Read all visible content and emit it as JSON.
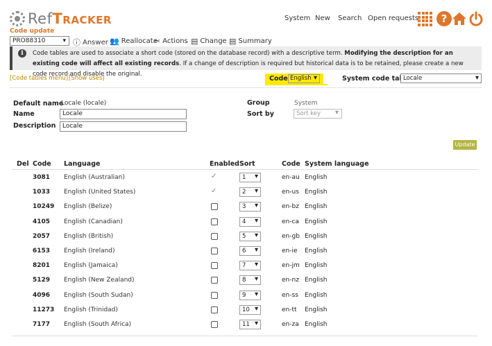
{
  "app": {
    "name_part1": "Ref",
    "name_part2": "Tracker",
    "subtitle": "Code update"
  },
  "topnav": {
    "system": "System",
    "new": "New",
    "search": "Search",
    "open_requests": "Open requests"
  },
  "toolbar": {
    "record": "PRO88310",
    "answer": "Answer",
    "reallocate": "Reallocate",
    "actions": "Actions",
    "change": "Change",
    "summary": "Summary"
  },
  "banner": {
    "part1": "Code tables are used to associate a short code (stored on the database record) with a descriptive term. ",
    "bold": "Modifying the description for an existing code will affect all existing records",
    "part2": ". If a change of description is required but historical data is to be retained, please create a new code record and disable the original."
  },
  "links": {
    "menu": "[Code tables menu]",
    "show_uses": "[Show uses]"
  },
  "code_filter": {
    "label": "Code",
    "value": "English"
  },
  "system_tables": {
    "label": "System code tables",
    "value": "Locale"
  },
  "form": {
    "default_name_label": "Default name",
    "default_name_value": "Locale (locale)",
    "name_label": "Name",
    "name_value": "Locale",
    "description_label": "Description",
    "description_value": "Locale",
    "group_label": "Group",
    "group_value": "System",
    "sortby_label": "Sort by",
    "sortby_value": "Sort key",
    "update_label": "Update"
  },
  "table": {
    "headers": {
      "del": "Del",
      "code": "Code",
      "language": "Language",
      "enabled": "Enabled",
      "sort": "Sort",
      "loc_code": "Code",
      "system_language": "System language"
    },
    "rows": [
      {
        "code": "3081",
        "language": "English (Australian)",
        "enabled": true,
        "sort": "1",
        "loc": "en-au",
        "sys": "English"
      },
      {
        "code": "1033",
        "language": "English (United States)",
        "enabled": true,
        "sort": "2",
        "loc": "en-us",
        "sys": "English"
      },
      {
        "code": "10249",
        "language": "English (Belize)",
        "enabled": false,
        "sort": "3",
        "loc": "en-bz",
        "sys": "English"
      },
      {
        "code": "4105",
        "language": "English (Canadian)",
        "enabled": false,
        "sort": "4",
        "loc": "en-ca",
        "sys": "English"
      },
      {
        "code": "2057",
        "language": "English (British)",
        "enabled": false,
        "sort": "5",
        "loc": "en-gb",
        "sys": "English"
      },
      {
        "code": "6153",
        "language": "English (Ireland)",
        "enabled": false,
        "sort": "6",
        "loc": "en-ie",
        "sys": "English"
      },
      {
        "code": "8201",
        "language": "English (Jamaica)",
        "enabled": false,
        "sort": "7",
        "loc": "en-jm",
        "sys": "English"
      },
      {
        "code": "5129",
        "language": "English (New Zealand)",
        "enabled": false,
        "sort": "8",
        "loc": "en-nz",
        "sys": "English"
      },
      {
        "code": "4096",
        "language": "English (South Sudan)",
        "enabled": false,
        "sort": "9",
        "loc": "en-ss",
        "sys": "English"
      },
      {
        "code": "11273",
        "language": "English (Trinidad)",
        "enabled": false,
        "sort": "10",
        "loc": "en-tt",
        "sys": "English"
      },
      {
        "code": "7177",
        "language": "English (South Africa)",
        "enabled": false,
        "sort": "11",
        "loc": "en-za",
        "sys": "English"
      }
    ]
  },
  "colors": {
    "accent": "#e0762a",
    "highlight": "#ffea00",
    "link": "#b58900",
    "update_button": "#b5b544"
  }
}
